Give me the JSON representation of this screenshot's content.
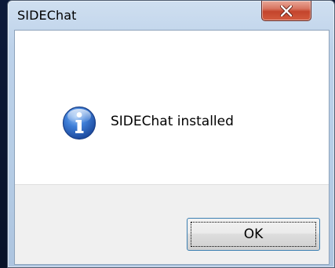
{
  "window": {
    "title": "SIDEChat"
  },
  "dialog": {
    "message": "SIDEChat installed",
    "icon": "information-icon",
    "ok_label": "OK"
  },
  "colors": {
    "frame": "#bdd2ea",
    "close_button": "#c4452c",
    "button_area": "#f0f0f0",
    "info_icon": "#2a63c2"
  }
}
